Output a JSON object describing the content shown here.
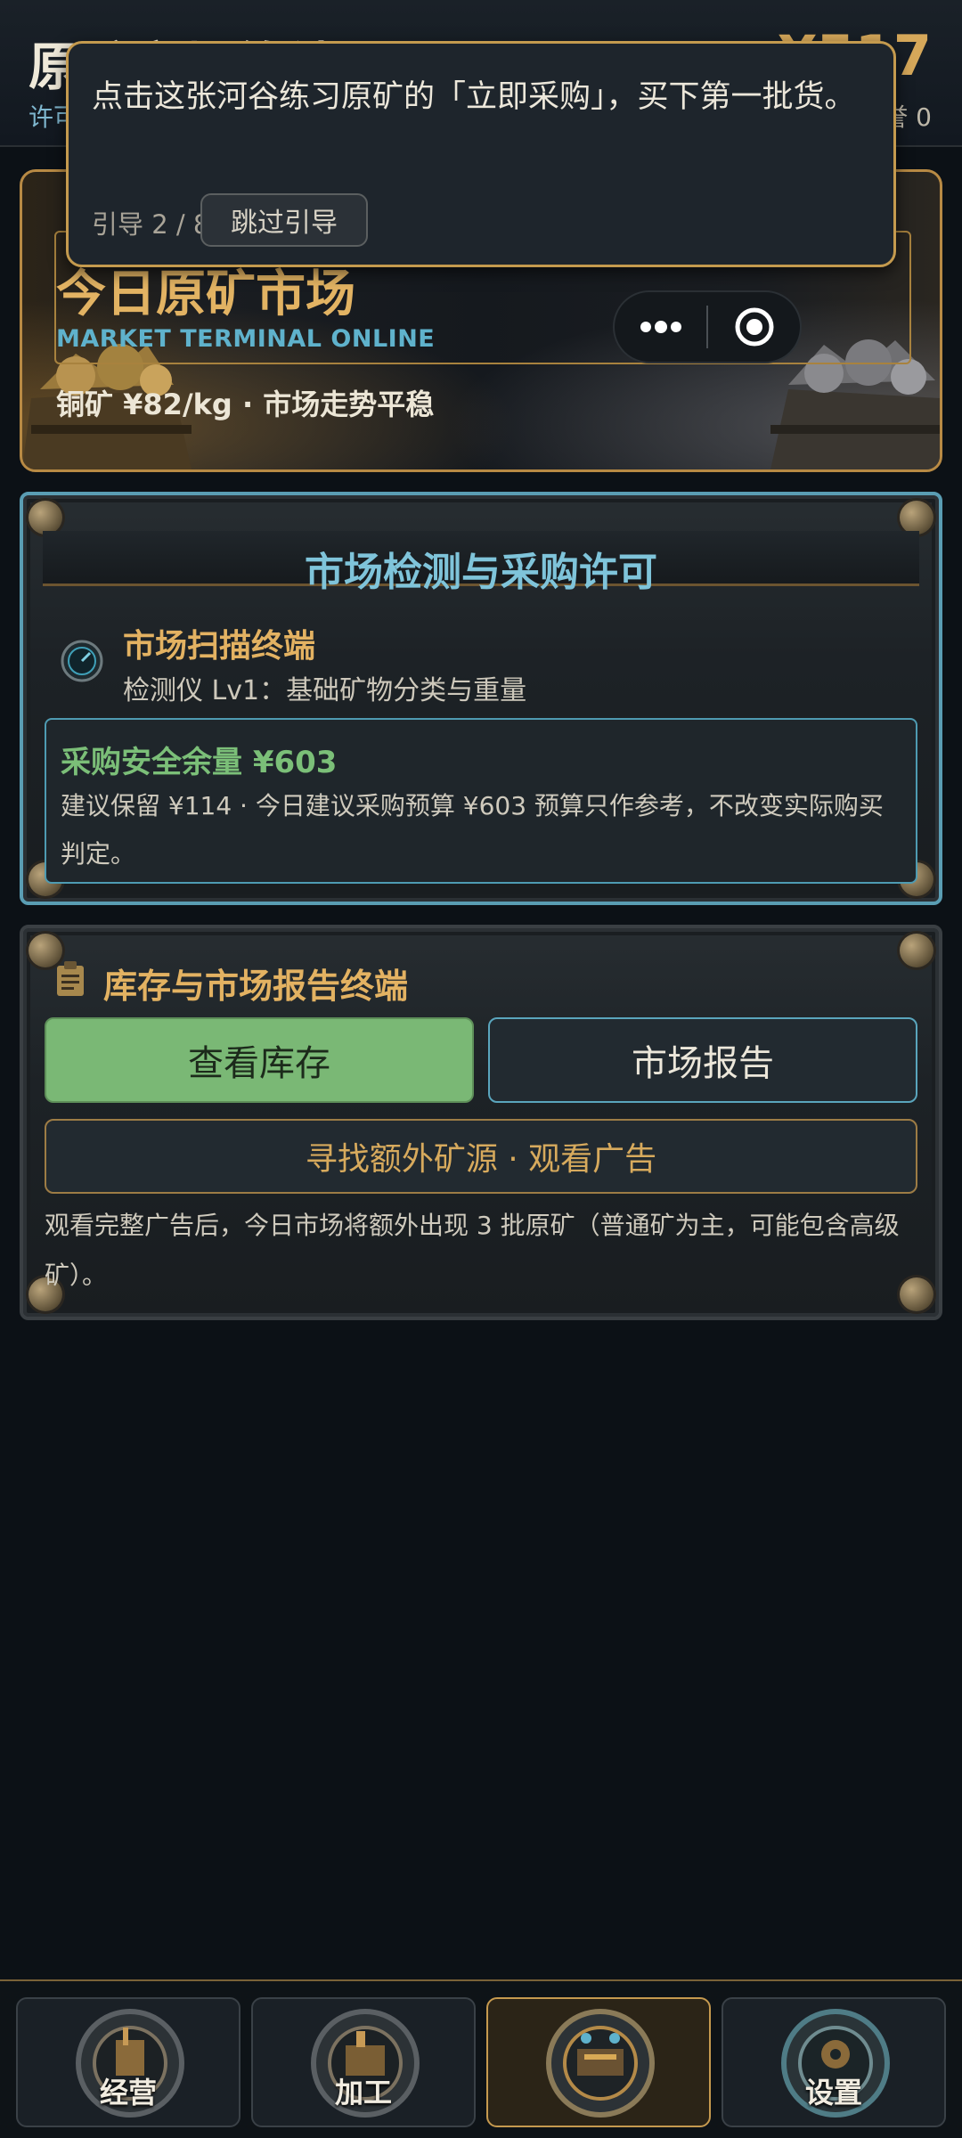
{
  "header": {
    "title": "原矿市场终端",
    "subtitle": "许可",
    "money": "¥517",
    "reputation": "誉 0"
  },
  "hero": {
    "title": "今日原矿市场",
    "subtitle_en": "MARKET TERMINAL ONLINE",
    "price_line": "铜矿 ¥82/kg  ·  市场走势平稳"
  },
  "guide": {
    "text": "点击这张河谷练习原矿的「立即采购」，买下第一批货。",
    "step": "引导 2 / 8",
    "skip_label": "跳过引导"
  },
  "capsule": {
    "more_icon": "more-dots-icon",
    "close_icon": "target-close-icon"
  },
  "permit_panel": {
    "title": "市场检测与采购许可",
    "scanner_title": "市场扫描终端",
    "scanner_sub": "检测仪 Lv1：基础矿物分类与重量",
    "safe_title": "采购安全余量 ¥603",
    "safe_desc": "建议保留 ¥114 · 今日建议采购预算 ¥603 预算只作参考，不改变实际购买判定。"
  },
  "inventory_panel": {
    "title": "库存与市场报告终端",
    "stock_button": "查看库存",
    "report_button": "市场报告",
    "ad_button": "寻找额外矿源 · 观看广告",
    "ad_desc": "观看完整广告后，今日市场将额外出现 3 批原矿（普通矿为主，可能包含高级矿）。"
  },
  "nav": {
    "tabs": [
      {
        "label": "经营",
        "icon": "business-icon",
        "active": false
      },
      {
        "label": "加工",
        "icon": "processing-icon",
        "active": false
      },
      {
        "label": "",
        "icon": "market-icon",
        "active": true
      },
      {
        "label": "设置",
        "icon": "settings-icon",
        "active": false
      }
    ]
  },
  "colors": {
    "accent_gold": "#d6a85a",
    "accent_blue": "#7fc4da",
    "accent_green": "#7ab875",
    "background": "#0c1116"
  }
}
